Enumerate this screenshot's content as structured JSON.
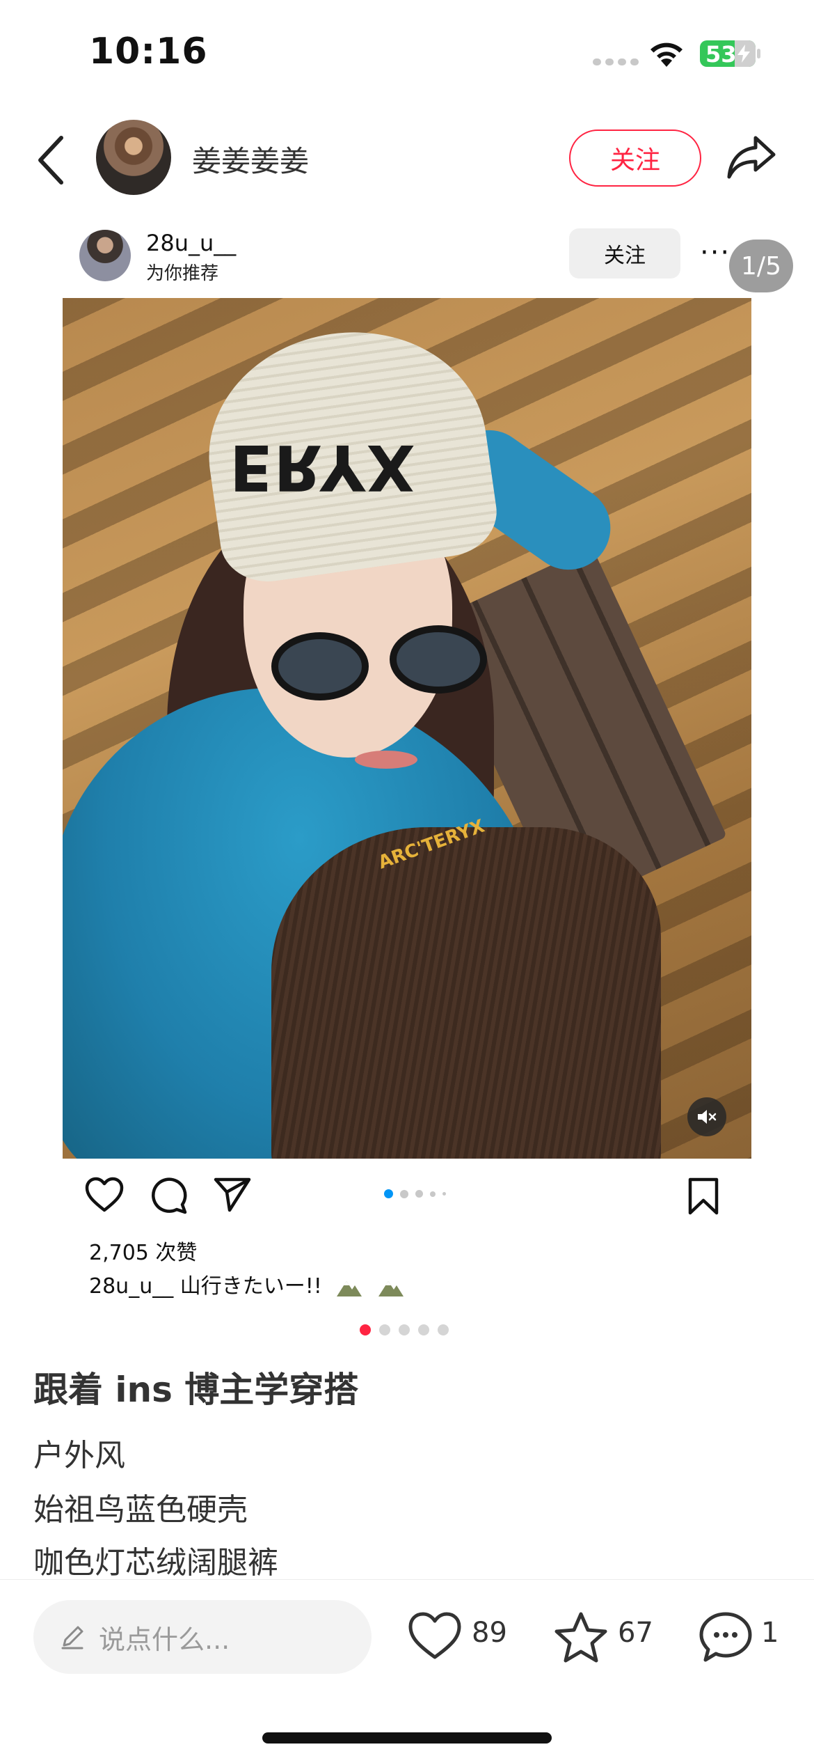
{
  "status_bar": {
    "time": "10:16",
    "battery": "53",
    "battery_color": "#34c759"
  },
  "nav": {
    "author_name": "姜姜姜姜",
    "follow_label": "关注",
    "accent_color": "#ff2442",
    "icons": [
      "chevron-left-icon",
      "share-icon"
    ]
  },
  "embedded_post": {
    "username": "28u_u__",
    "subtitle": "为你推荐",
    "follow_label": "关注",
    "more": "···",
    "page_counter": "1/5",
    "likes": "2,705 次赞",
    "caption_user": "28u_u__",
    "caption_text": "山行きたいー!!",
    "photo_text": "ERYX",
    "photo_logo": "ARC'TERYX",
    "icons": [
      "heart-icon",
      "comment-icon",
      "send-icon",
      "bookmark-icon",
      "mute-icon",
      "mountain-icon"
    ]
  },
  "note": {
    "title": "跟着 ins 博主学穿搭",
    "lines": [
      "户外风",
      "始祖鸟蓝色硬壳",
      "咖色灯芯绒阔腿裤"
    ]
  },
  "bottom_bar": {
    "comment_placeholder": "说点什么...",
    "like_count": "89",
    "collect_count": "67",
    "comment_count": "1",
    "icons": [
      "pencil-icon",
      "heart-icon",
      "star-icon",
      "chat-bubble-icon"
    ]
  }
}
